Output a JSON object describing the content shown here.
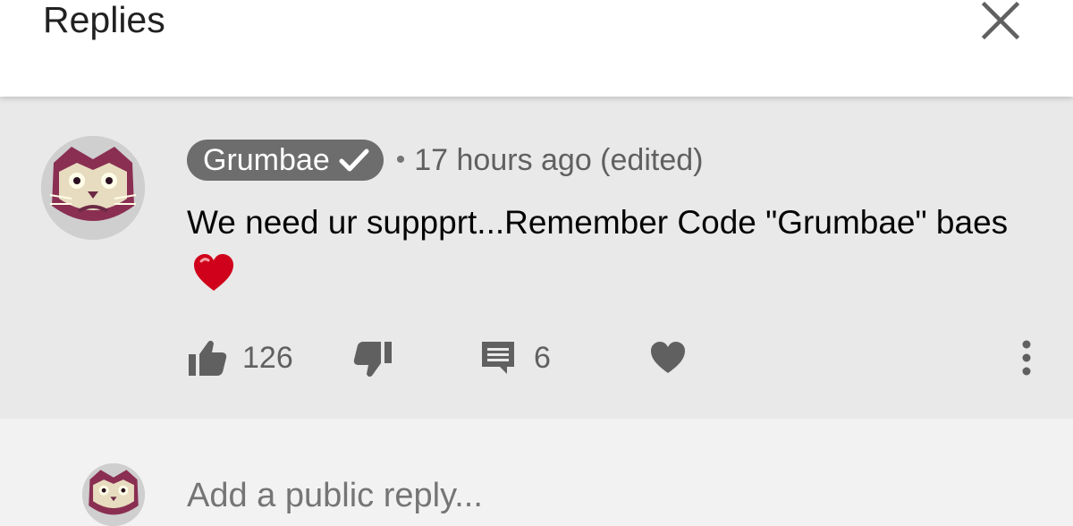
{
  "header": {
    "title": "Replies",
    "close_icon": "close-icon"
  },
  "comment": {
    "author": "Grumbae",
    "verified_icon": "check-icon",
    "separator": "•",
    "timestamp": "17 hours ago (edited)",
    "text": "We need ur suppprt...Remember Code \"Grumbae\" baes",
    "emoji": "red-heart",
    "likes": "126",
    "replies": "6",
    "colors": {
      "badge_bg": "#6d6d6d",
      "heart": "#d0021b",
      "icon": "#606060"
    }
  },
  "reply_box": {
    "placeholder": "Add a public reply..."
  }
}
